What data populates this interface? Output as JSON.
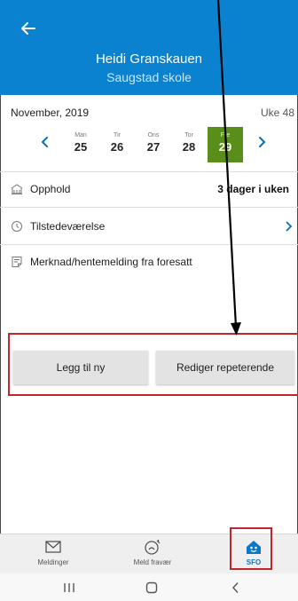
{
  "header": {
    "student_name": "Heidi Granskauen",
    "school": "Saugstad skole"
  },
  "calendar": {
    "month_label": "November, 2019",
    "week_label": "Uke 48",
    "days": [
      {
        "name": "Man",
        "date": "25",
        "selected": false
      },
      {
        "name": "Tir",
        "date": "26",
        "selected": false
      },
      {
        "name": "Ons",
        "date": "27",
        "selected": false
      },
      {
        "name": "Tor",
        "date": "28",
        "selected": false
      },
      {
        "name": "Fre",
        "date": "29",
        "selected": true
      }
    ]
  },
  "rows": {
    "stay_label": "Opphold",
    "stay_value": "3 dager i uken",
    "attendance_label": "Tilstedeværelse",
    "note_label": "Merknad/hentemelding fra foresatt"
  },
  "buttons": {
    "add_new": "Legg til ny",
    "edit_recurring": "Rediger repeterende"
  },
  "bottom_nav": {
    "items": [
      {
        "label": "Meldinger",
        "icon": "envelope-icon",
        "active": false
      },
      {
        "label": "Meld fravær",
        "icon": "report-absence-icon",
        "active": false
      },
      {
        "label": "SFO",
        "icon": "sfo-house-icon",
        "active": true
      }
    ]
  },
  "colors": {
    "header_blue": "#0a82d0",
    "selected_day_green": "#5a8e1a",
    "highlight_red": "#c0262b",
    "active_nav_blue": "#0a78c8"
  }
}
